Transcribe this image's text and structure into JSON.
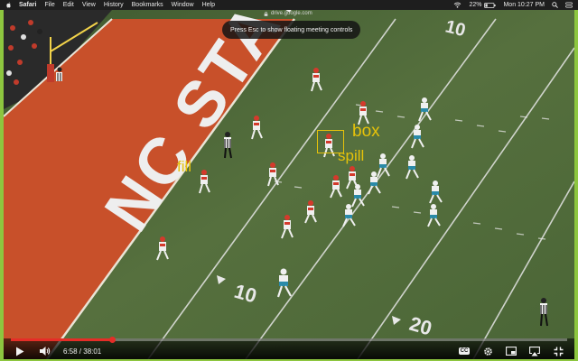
{
  "menubar": {
    "app": "Safari",
    "items": [
      "File",
      "Edit",
      "View",
      "History",
      "Bookmarks",
      "Window",
      "Help"
    ],
    "battery": "22%",
    "datetime": "Mon 10:27 PM",
    "icons": [
      "apple-icon",
      "wifi-icon",
      "battery-icon",
      "search-icon",
      "control-center-icon"
    ]
  },
  "browser": {
    "url": "drive.google.com"
  },
  "toast": {
    "text": "Press Esc to show floating meeting controls"
  },
  "video": {
    "field_text": "NC STATE",
    "yard_markers": [
      "10",
      "10",
      "20"
    ],
    "annotations": {
      "box": "box",
      "spill": "spill",
      "fill": "fill"
    },
    "colors": {
      "annotation": "#e6c20a",
      "endzone": "#c8502a",
      "turf": "#4e6a3a",
      "progress": "#e52d27"
    }
  },
  "player": {
    "current_time": "6:58",
    "duration": "38:01",
    "time_display": "6:58 / 38:01",
    "progress": 0.183,
    "cc_label": "CC",
    "icons": [
      "play-icon",
      "volume-icon",
      "cc-icon",
      "settings-icon",
      "miniplayer-icon",
      "airplay-icon",
      "fullscreen-icon"
    ]
  }
}
